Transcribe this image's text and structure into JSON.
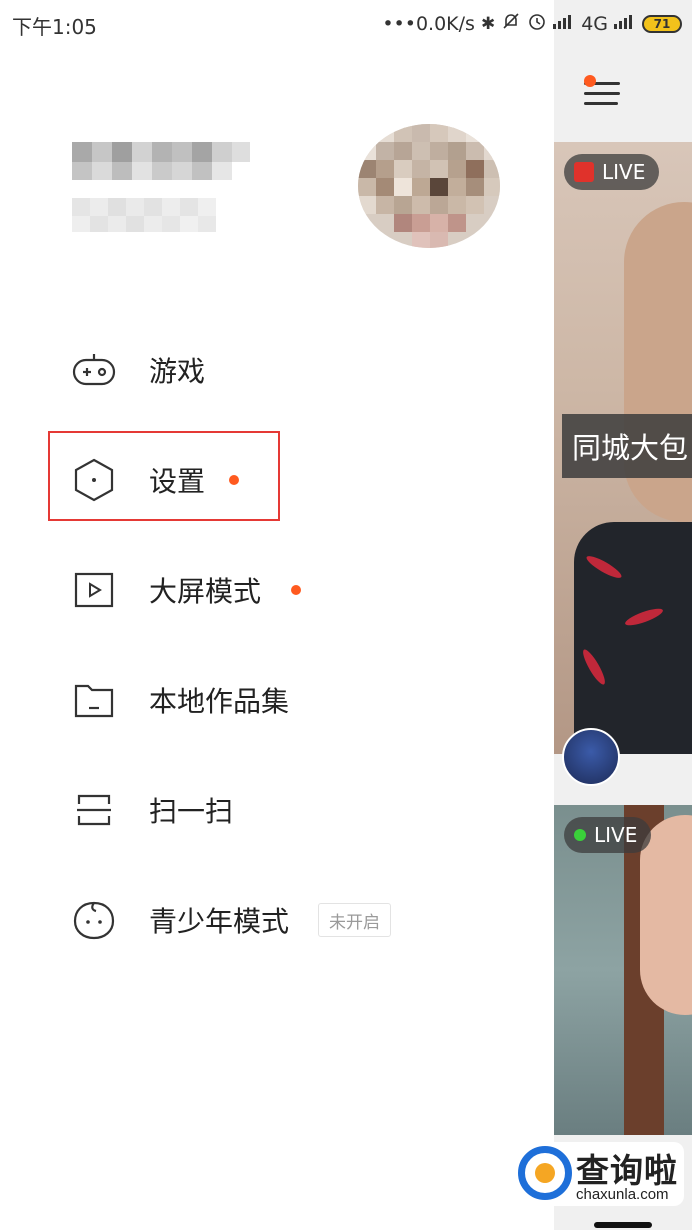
{
  "status_bar": {
    "time": "下午1:05",
    "network_speed": "•••0.0K/s",
    "signal_label": "4G",
    "battery_level": "71"
  },
  "profile": {
    "name_pixelated": true,
    "avatar_pixelated": true
  },
  "menu": {
    "items": [
      {
        "label": "游戏",
        "icon": "gamepad-icon",
        "has_dot": false
      },
      {
        "label": "设置",
        "icon": "hexagon-settings-icon",
        "has_dot": true
      },
      {
        "label": "大屏模式",
        "icon": "play-box-icon",
        "has_dot": true
      },
      {
        "label": "本地作品集",
        "icon": "folder-icon",
        "has_dot": false
      },
      {
        "label": "扫一扫",
        "icon": "scan-icon",
        "has_dot": false
      },
      {
        "label": "青少年模式",
        "icon": "child-face-icon",
        "has_dot": false,
        "badge": "未开启"
      }
    ],
    "highlighted_item": "设置"
  },
  "feed": {
    "cards": [
      {
        "live_label": "LIVE",
        "live_mark": "red",
        "tag": "同城大包"
      },
      {
        "live_label": "LIVE",
        "live_mark": "green"
      }
    ]
  },
  "watermark": {
    "title": "查询啦",
    "url": "chaxunla.com"
  },
  "colors": {
    "accent_dot": "#ff5a1f",
    "highlight_border": "#e53935"
  }
}
